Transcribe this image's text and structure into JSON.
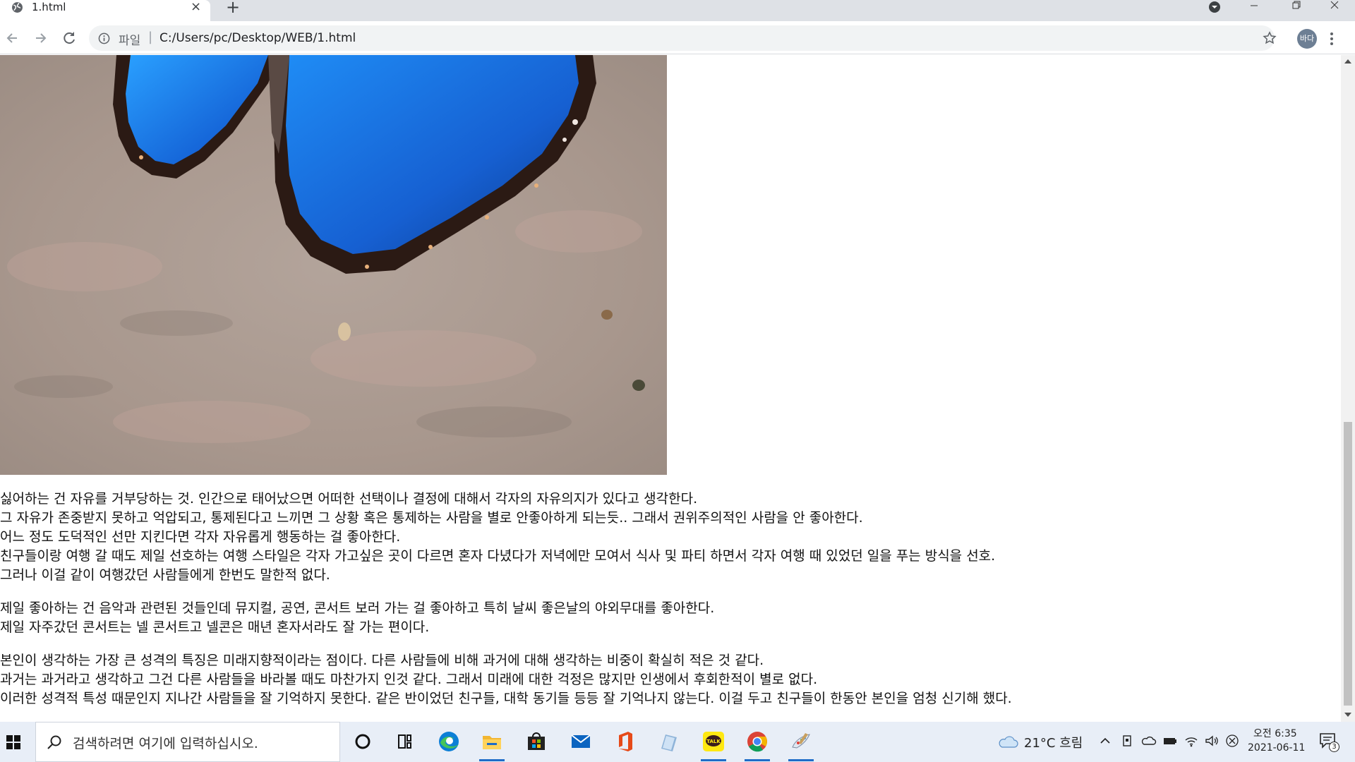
{
  "browser": {
    "tab_title": "1.html",
    "tab_close": "×",
    "new_tab": "+",
    "scheme_label": "파일",
    "url_separator": "|",
    "url": "C:/Users/pc/Desktop/WEB/1.html",
    "profile_initials": "바다"
  },
  "page": {
    "image_subject": "blue morpho butterfly on stone",
    "paragraphs": [
      [
        "싫어하는 건 자유를 거부당하는 것. 인간으로 태어났으면 어떠한 선택이나 결정에 대해서 각자의 자유의지가 있다고 생각한다.",
        "그 자유가 존중받지 못하고 억압되고, 통제된다고 느끼면 그 상황 혹은 통제하는 사람을 별로 안좋아하게 되는듯.. 그래서 권위주의적인 사람을 안 좋아한다.",
        "어느 정도 도덕적인 선만 지킨다면 각자 자유롭게 행동하는 걸 좋아한다.",
        "친구들이랑 여행 갈 때도 제일 선호하는 여행 스타일은 각자 가고싶은 곳이 다르면 혼자 다녔다가 저녁에만 모여서 식사 및 파티 하면서 각자 여행 때 있었던 일을 푸는 방식을 선호.",
        "그러나 이걸 같이 여행갔던 사람들에게 한번도 말한적 없다."
      ],
      [
        "제일 좋아하는 건 음악과 관련된 것들인데 뮤지컬, 공연, 콘서트 보러 가는 걸 좋아하고 특히 날씨 좋은날의 야외무대를 좋아한다.",
        "제일 자주갔던 콘서트는 넬 콘서트고 넬콘은 매년 혼자서라도 잘 가는 편이다."
      ],
      [
        "본인이 생각하는 가장 큰 성격의 특징은 미래지향적이라는 점이다. 다른 사람들에 비해 과거에 대해 생각하는 비중이 확실히 적은 것 같다.",
        "과거는 과거라고 생각하고 그건 다른 사람들을 바라볼 때도 마찬가지 인것 같다. 그래서 미래에 대한 걱정은 많지만 인생에서 후회한적이 별로 없다.",
        "이러한 성격적 특성 때문인지 지나간 사람들을 잘 기억하지 못한다. 같은 반이었던 친구들, 대학 동기들 등등 잘 기억나지 않는다. 이걸 두고 친구들이 한동안 본인을 엄청 신기해 했다."
      ]
    ],
    "scroll_position": 0.55
  },
  "taskbar": {
    "search_placeholder": "검색하려면 여기에 입력하십시오.",
    "weather": "21°C  흐림",
    "clock_time": "오전 6:35",
    "clock_date": "2021-06-11",
    "notification_count": "3",
    "pinned_icons": [
      "cortana-icon",
      "task-view-icon",
      "edge-icon",
      "file-explorer-icon",
      "store-icon",
      "mail-icon",
      "office-icon",
      "notepad-icon",
      "kakaotalk-icon",
      "chrome-icon",
      "paint-icon"
    ],
    "kakaotalk_label": "TALK"
  },
  "colors": {
    "tabstrip": "#dee1e6",
    "omnibox": "#f1f3f4",
    "taskbar": "#e8eef7",
    "butterfly_blue": "#1a78e0"
  }
}
